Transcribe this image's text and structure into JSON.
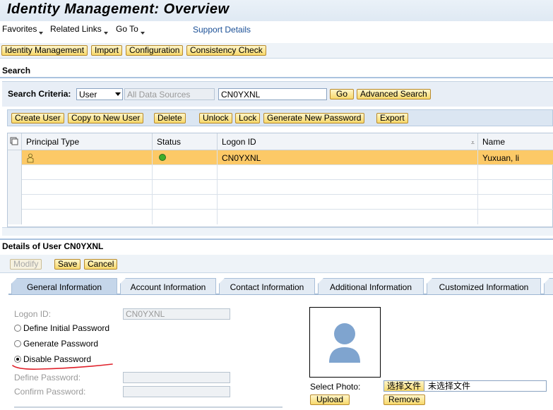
{
  "title": "Identity Management: Overview",
  "menus": [
    {
      "label": "Favorites"
    },
    {
      "label": "Related Links"
    },
    {
      "label": "Go To"
    }
  ],
  "support_link": "Support Details",
  "top_tabs": [
    "Identity Management",
    "Import",
    "Configuration",
    "Consistency Check"
  ],
  "search": {
    "section_title": "Search",
    "criteria_label": "Search Criteria:",
    "criteria_value": "User",
    "datasource_placeholder": "All Data Sources",
    "query_value": "CN0YXNL",
    "go_label": "Go",
    "advanced_label": "Advanced Search"
  },
  "actions": [
    "Create User",
    "Copy to New User",
    "Delete",
    "Unlock",
    "Lock",
    "Generate New Password",
    "Export"
  ],
  "table": {
    "columns": [
      "Principal Type",
      "Status",
      "Logon ID",
      "Name"
    ],
    "rows": [
      {
        "logon_id": "CN0YXNL",
        "name": "Yuxuan, li"
      }
    ]
  },
  "details": {
    "title": "Details of User CN0YXNL",
    "modify_label": "Modify",
    "save_label": "Save",
    "cancel_label": "Cancel",
    "tabs": [
      "General Information",
      "Account Information",
      "Contact Information",
      "Additional Information",
      "Customized Information"
    ],
    "logon_id_label": "Logon ID:",
    "logon_id_value": "CN0YXNL",
    "radio_define": "Define Initial Password",
    "radio_generate": "Generate Password",
    "radio_disable": "Disable Password",
    "define_pw_label": "Define Password:",
    "confirm_pw_label": "Confirm Password:",
    "select_photo_label": "Select Photo:",
    "choose_file_label": "选择文件",
    "no_file_label": "未选择文件",
    "upload_label": "Upload",
    "remove_label": "Remove"
  },
  "colors": {
    "selected_row": "#fcc967",
    "status_ok": "#3fae2a",
    "annotation_red": "#e0202a"
  }
}
